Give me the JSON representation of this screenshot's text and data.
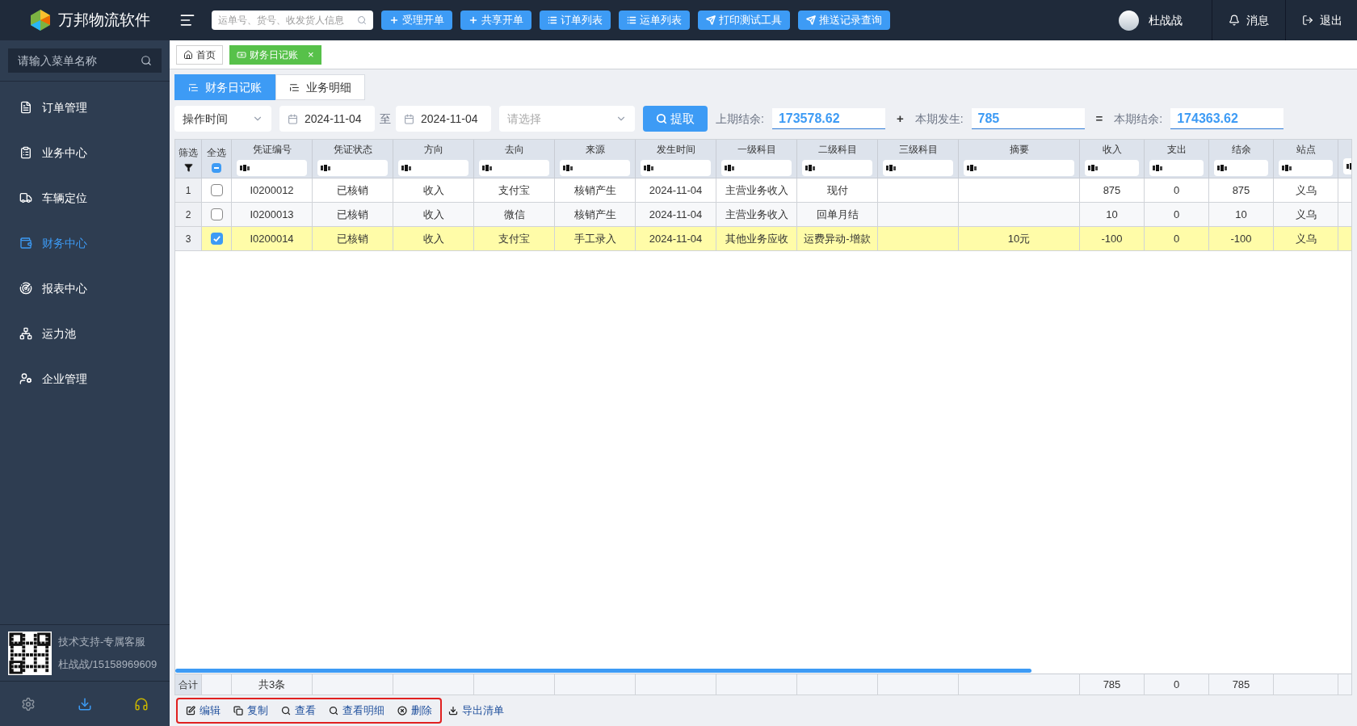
{
  "brand": {
    "name": "万邦物流软件"
  },
  "header": {
    "search_placeholder": "运单号、货号、收发货人信息",
    "buttons": [
      {
        "label": "受理开单",
        "kind": "plus"
      },
      {
        "label": "共享开单",
        "kind": "plus"
      },
      {
        "label": "订单列表",
        "kind": "list"
      },
      {
        "label": "运单列表",
        "kind": "list"
      },
      {
        "label": "打印测试工具",
        "kind": "send"
      },
      {
        "label": "推送记录查询",
        "kind": "send"
      }
    ],
    "user": "杜战战",
    "messages": "消息",
    "logout": "退出"
  },
  "sidebar": {
    "search_placeholder": "请输入菜单名称",
    "items": [
      {
        "label": "订单管理",
        "kind": "order",
        "selected": false
      },
      {
        "label": "业务中心",
        "kind": "business",
        "selected": false
      },
      {
        "label": "车辆定位",
        "kind": "truck",
        "selected": false
      },
      {
        "label": "财务中心",
        "kind": "finance",
        "selected": true
      },
      {
        "label": "报表中心",
        "kind": "report",
        "selected": false
      },
      {
        "label": "运力池",
        "kind": "pool",
        "selected": false
      },
      {
        "label": "企业管理",
        "kind": "company",
        "selected": false
      }
    ],
    "support": [
      "技术支持-专属客服",
      "杜战战/15158969609"
    ]
  },
  "page_tabs": [
    {
      "label": "首页",
      "kind": "home",
      "selected": false
    },
    {
      "label": "财务日记账",
      "kind": "money",
      "selected": true,
      "close": "×"
    }
  ],
  "sub_tabs": [
    {
      "label": "财务日记账",
      "selected": true
    },
    {
      "label": "业务明细",
      "selected": false
    }
  ],
  "filters": {
    "time_type": "操作时间",
    "date_from": "2024-11-04",
    "to": "至",
    "date_to": "2024-11-04",
    "select_placeholder": "请选择",
    "fetch": "提取",
    "prev_label": "上期结余:",
    "prev_value": "173578.62",
    "plus": "+",
    "current_label": "本期发生:",
    "current_value": "785",
    "equals": "=",
    "end_label": "本期结余:",
    "end_value": "174363.62"
  },
  "table": {
    "filter_header": "筛选",
    "select_all": "全选",
    "select_all_indeterminate": true,
    "columns": [
      "凭证编号",
      "凭证状态",
      "方向",
      "去向",
      "来源",
      "发生时间",
      "一级科目",
      "二级科目",
      "三级科目",
      "摘要",
      "收入",
      "支出",
      "结余",
      "站点"
    ],
    "rows": [
      {
        "index": "1",
        "checked": false,
        "cells": [
          "I0200012",
          "已核销",
          "收入",
          "支付宝",
          "核销产生",
          "2024-11-04",
          "主营业务收入",
          "现付",
          "",
          "",
          "875",
          "0",
          "875",
          "义乌"
        ]
      },
      {
        "index": "2",
        "checked": false,
        "cells": [
          "I0200013",
          "已核销",
          "收入",
          "微信",
          "核销产生",
          "2024-11-04",
          "主营业务收入",
          "回单月结",
          "",
          "",
          "10",
          "0",
          "10",
          "义乌"
        ]
      },
      {
        "index": "3",
        "checked": true,
        "cells": [
          "I0200014",
          "已核销",
          "收入",
          "支付宝",
          "手工录入",
          "2024-11-04",
          "其他业务应收",
          "运费异动-增款",
          "",
          "10元",
          "-100",
          "0",
          "-100",
          "义乌"
        ]
      }
    ],
    "summary": {
      "label": "合计",
      "count": "共3条",
      "cells": [
        "",
        "",
        "",
        "",
        "",
        "",
        "",
        "",
        "",
        "785",
        "0",
        "785",
        ""
      ]
    }
  },
  "actions": [
    {
      "label": "编辑",
      "kind": "edit"
    },
    {
      "label": "复制",
      "kind": "copy"
    },
    {
      "label": "查看",
      "kind": "search"
    },
    {
      "label": "查看明细",
      "kind": "search"
    },
    {
      "label": "删除",
      "kind": "delete"
    }
  ],
  "export": "导出清单"
}
